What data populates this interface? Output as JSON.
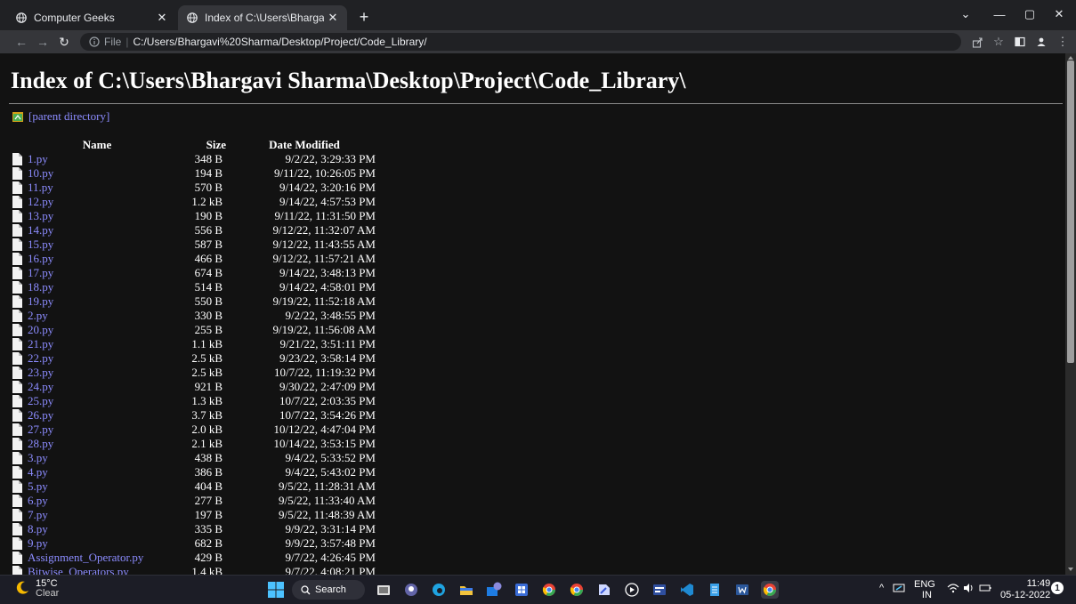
{
  "browser": {
    "tabs": [
      {
        "title": "Computer Geeks",
        "active": false
      },
      {
        "title": "Index of C:\\Users\\Bhargavi Sharm",
        "active": true
      }
    ],
    "new_tab_symbol": "+",
    "omnibox": {
      "scheme": "File",
      "separator": "|",
      "url": "C:/Users/Bhargavi%20Sharma/Desktop/Project/Code_Library/"
    },
    "toolbar_icons": [
      "back-icon",
      "forward-icon",
      "reload-icon",
      "info-icon",
      "share-icon",
      "star-icon",
      "sidepanel-icon",
      "profile-icon",
      "menu-icon"
    ],
    "window_controls": [
      "tab-search-icon",
      "minimize-icon",
      "restore-icon",
      "close-icon"
    ]
  },
  "page": {
    "heading": "Index of C:\\Users\\Bhargavi Sharma\\Desktop\\Project\\Code_Library\\",
    "parent_link": "[parent directory]",
    "columns": {
      "name": "Name",
      "size": "Size",
      "date": "Date Modified"
    },
    "files": [
      {
        "name": "1.py",
        "size": "348 B",
        "date": "9/2/22, 3:29:33 PM"
      },
      {
        "name": "10.py",
        "size": "194 B",
        "date": "9/11/22, 10:26:05 PM"
      },
      {
        "name": "11.py",
        "size": "570 B",
        "date": "9/14/22, 3:20:16 PM"
      },
      {
        "name": "12.py",
        "size": "1.2 kB",
        "date": "9/14/22, 4:57:53 PM"
      },
      {
        "name": "13.py",
        "size": "190 B",
        "date": "9/11/22, 11:31:50 PM"
      },
      {
        "name": "14.py",
        "size": "556 B",
        "date": "9/12/22, 11:32:07 AM"
      },
      {
        "name": "15.py",
        "size": "587 B",
        "date": "9/12/22, 11:43:55 AM"
      },
      {
        "name": "16.py",
        "size": "466 B",
        "date": "9/12/22, 11:57:21 AM"
      },
      {
        "name": "17.py",
        "size": "674 B",
        "date": "9/14/22, 3:48:13 PM"
      },
      {
        "name": "18.py",
        "size": "514 B",
        "date": "9/14/22, 4:58:01 PM"
      },
      {
        "name": "19.py",
        "size": "550 B",
        "date": "9/19/22, 11:52:18 AM"
      },
      {
        "name": "2.py",
        "size": "330 B",
        "date": "9/2/22, 3:48:55 PM"
      },
      {
        "name": "20.py",
        "size": "255 B",
        "date": "9/19/22, 11:56:08 AM"
      },
      {
        "name": "21.py",
        "size": "1.1 kB",
        "date": "9/21/22, 3:51:11 PM"
      },
      {
        "name": "22.py",
        "size": "2.5 kB",
        "date": "9/23/22, 3:58:14 PM"
      },
      {
        "name": "23.py",
        "size": "2.5 kB",
        "date": "10/7/22, 11:19:32 PM"
      },
      {
        "name": "24.py",
        "size": "921 B",
        "date": "9/30/22, 2:47:09 PM"
      },
      {
        "name": "25.py",
        "size": "1.3 kB",
        "date": "10/7/22, 2:03:35 PM"
      },
      {
        "name": "26.py",
        "size": "3.7 kB",
        "date": "10/7/22, 3:54:26 PM"
      },
      {
        "name": "27.py",
        "size": "2.0 kB",
        "date": "10/12/22, 4:47:04 PM"
      },
      {
        "name": "28.py",
        "size": "2.1 kB",
        "date": "10/14/22, 3:53:15 PM"
      },
      {
        "name": "3.py",
        "size": "438 B",
        "date": "9/4/22, 5:33:52 PM"
      },
      {
        "name": "4.py",
        "size": "386 B",
        "date": "9/4/22, 5:43:02 PM"
      },
      {
        "name": "5.py",
        "size": "404 B",
        "date": "9/5/22, 11:28:31 AM"
      },
      {
        "name": "6.py",
        "size": "277 B",
        "date": "9/5/22, 11:33:40 AM"
      },
      {
        "name": "7.py",
        "size": "197 B",
        "date": "9/5/22, 11:48:39 AM"
      },
      {
        "name": "8.py",
        "size": "335 B",
        "date": "9/9/22, 3:31:14 PM"
      },
      {
        "name": "9.py",
        "size": "682 B",
        "date": "9/9/22, 3:57:48 PM"
      },
      {
        "name": "Assignment_Operator.py",
        "size": "429 B",
        "date": "9/7/22, 4:26:45 PM"
      },
      {
        "name": "Bitwise_Operators.py",
        "size": "1.4 kB",
        "date": "9/7/22, 4:08:21 PM"
      }
    ]
  },
  "taskbar": {
    "weather": {
      "temp": "15°C",
      "condition": "Clear"
    },
    "search_label": "Search",
    "apps": [
      "file-explorer-icon",
      "teams-icon",
      "edge-icon",
      "folder-icon",
      "mail-icon",
      "store-icon",
      "chrome-icon",
      "chrome-alt-icon",
      "app-icon",
      "media-player-icon",
      "dev-icon",
      "vscode-icon",
      "notepad-icon",
      "word-icon",
      "chrome-active-icon"
    ],
    "tray": {
      "lang": "ENG",
      "region": "IN",
      "time": "11:49",
      "date": "05-12-2022",
      "notifications": "1"
    }
  },
  "colors": {
    "page_bg": "#121212",
    "link": "#8c8cff",
    "tab_strip": "#202124",
    "toolbar": "#35363a",
    "taskbar": "#1c1d26"
  }
}
